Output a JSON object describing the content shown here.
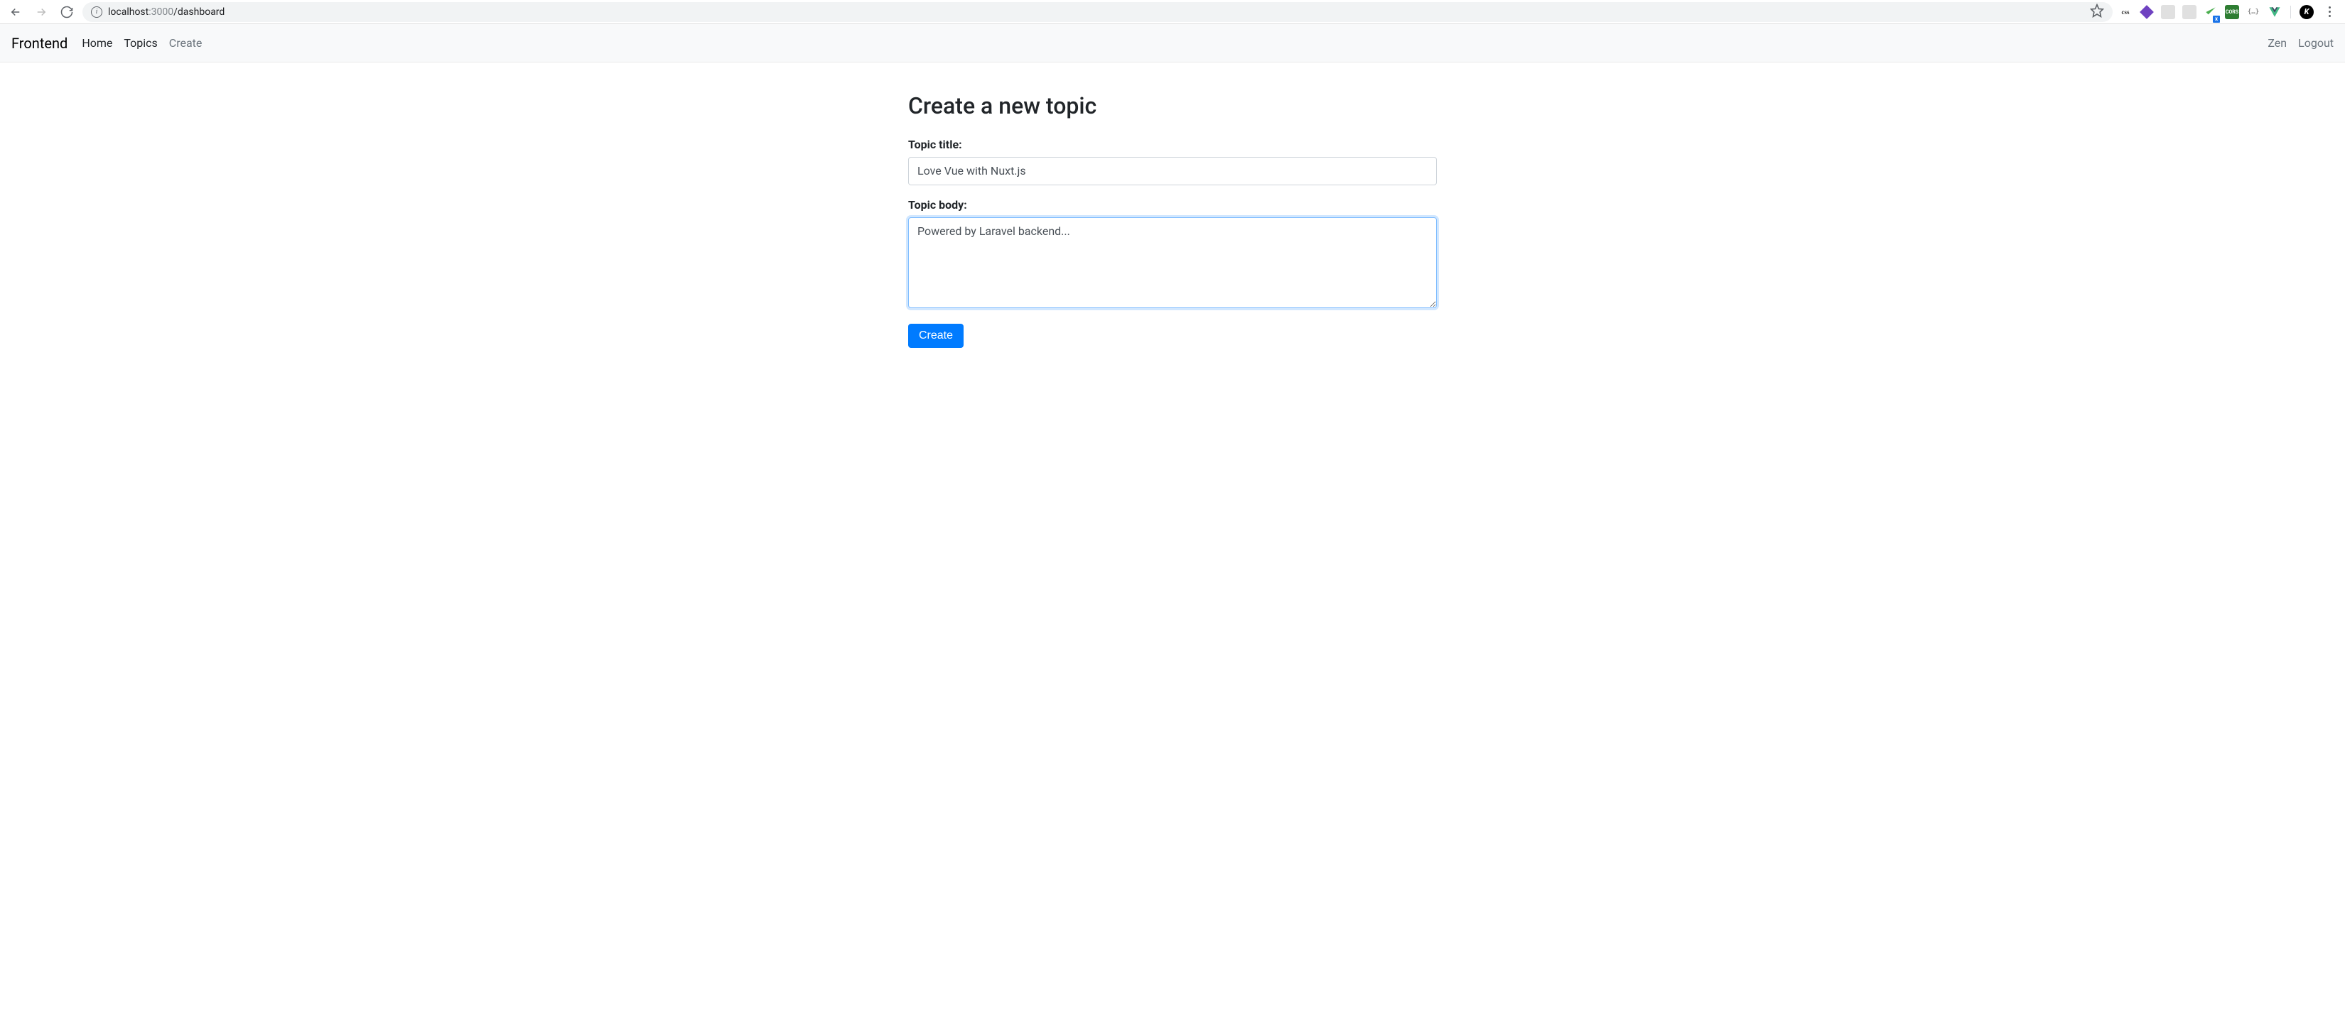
{
  "browser": {
    "url_host": "localhost",
    "url_port": ":3000",
    "url_path": "/dashboard"
  },
  "navbar": {
    "brand": "Frontend",
    "links": {
      "home": "Home",
      "topics": "Topics",
      "create": "Create"
    },
    "right": {
      "user": "Zen",
      "logout": "Logout"
    }
  },
  "page": {
    "title": "Create a new topic",
    "form": {
      "title_label": "Topic title:",
      "title_value": "Love Vue with Nuxt.js",
      "body_label": "Topic body:",
      "body_value": "Powered by Laravel backend...",
      "submit_label": "Create"
    }
  }
}
